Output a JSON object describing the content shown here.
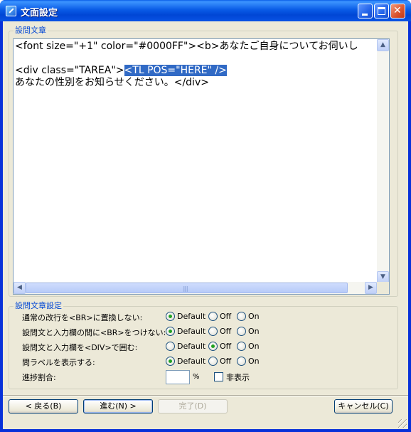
{
  "window": {
    "title": "文面設定"
  },
  "question_text": {
    "legend": "設問文章",
    "lines": [
      {
        "before": "<font size=\"+1\" color=\"#0000FF\"><b>あなたご自身についてお伺いし",
        "selected": "",
        "after": ""
      },
      {
        "before": "",
        "selected": "",
        "after": ""
      },
      {
        "before": "<div class=\"TAREA\">",
        "selected": "<TL POS=\"HERE\" />",
        "after": ""
      },
      {
        "before": "あなたの性別をお知らせください。</div>",
        "selected": "",
        "after": ""
      }
    ]
  },
  "settings": {
    "legend": "設問文章設定",
    "options": {
      "default": "Default",
      "off": "Off",
      "on": "On"
    },
    "rows": [
      {
        "label": "通常の改行を<BR>に置換しない:",
        "selected": "default"
      },
      {
        "label": "設問文と入力欄の間に<BR>をつけない:",
        "selected": "default"
      },
      {
        "label": "設問文と入力欄を<DIV>で囲む:",
        "selected": "off"
      },
      {
        "label": "問ラベルを表示する:",
        "selected": "default"
      }
    ],
    "progress": {
      "label": "進捗割合:",
      "value": "",
      "unit": "%",
      "hide_label": "非表示",
      "hide_checked": false
    }
  },
  "buttons": {
    "back": "< 戻る(B)",
    "next": "進む(N) >",
    "done": "完了(D)",
    "cancel": "キャンセル(C)"
  },
  "colors": {
    "selection": "#316ac5",
    "legend": "#0046d5",
    "titlebar": "#0a5ce6"
  }
}
